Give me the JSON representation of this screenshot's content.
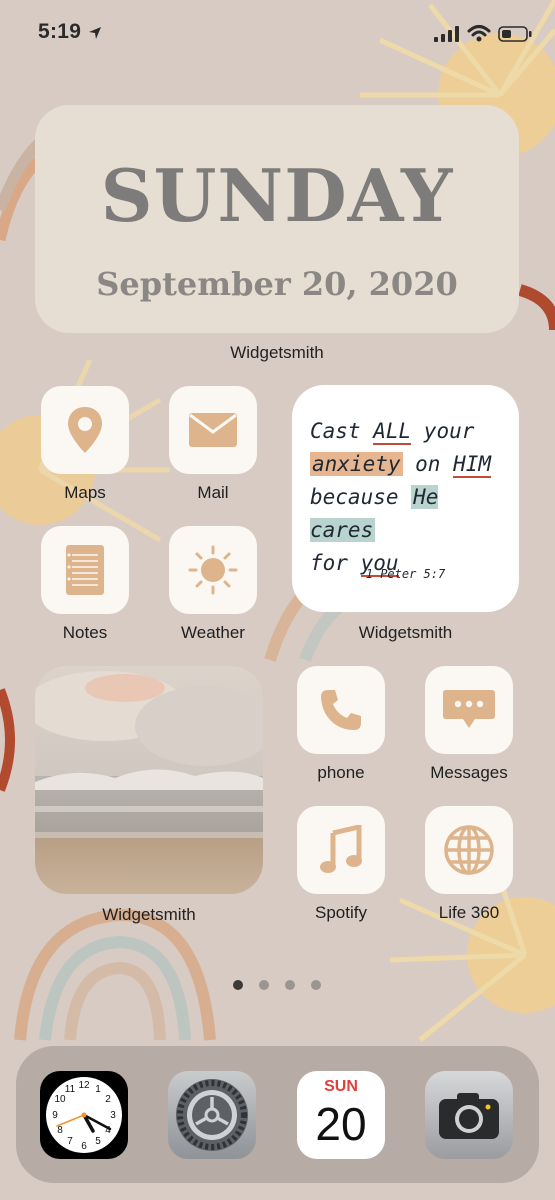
{
  "status_bar": {
    "time": "5:19",
    "icons": [
      "location-arrow-icon",
      "cellular-signal-icon",
      "wifi-icon",
      "battery-icon"
    ]
  },
  "date_widget": {
    "day": "SUNDAY",
    "date": "September 20, 2020",
    "label": "Widgetsmith"
  },
  "quote_widget": {
    "line1": "Cast ",
    "line1_em": "ALL",
    "line1_end": " your",
    "line2_hl": "anxiety",
    "line2_mid": " on ",
    "line2_em": "HIM",
    "line3": "because ",
    "line3_hl": "He cares",
    "line4": "for ",
    "line4_em": "you",
    "reference": "1 Peter 5:7",
    "label": "Widgetsmith"
  },
  "photo_widget": {
    "label": "Widgetsmith"
  },
  "apps": [
    {
      "label": "Maps",
      "icon": "map-pin-icon"
    },
    {
      "label": "Mail",
      "icon": "mail-icon"
    },
    {
      "label": "Notes",
      "icon": "notepad-icon"
    },
    {
      "label": "Weather",
      "icon": "sun-icon"
    },
    {
      "label": "phone",
      "icon": "phone-icon"
    },
    {
      "label": "Messages",
      "icon": "message-bubble-icon"
    },
    {
      "label": "Spotify",
      "icon": "music-note-icon"
    },
    {
      "label": "Life 360",
      "icon": "globe-icon"
    }
  ],
  "page_indicator": {
    "pages": 4,
    "current": 1
  },
  "dock": {
    "apps": [
      {
        "name": "Clock",
        "icon": "clock-icon",
        "numbers": [
          "12",
          "1",
          "2",
          "3",
          "4",
          "5",
          "6",
          "7",
          "8",
          "9",
          "10",
          "11"
        ]
      },
      {
        "name": "Settings",
        "icon": "gear-icon"
      },
      {
        "name": "Calendar",
        "icon": "calendar-icon",
        "day_abbrev": "SUN",
        "day_number": "20"
      },
      {
        "name": "Camera",
        "icon": "camera-icon"
      }
    ]
  },
  "colors": {
    "background": "#d8cbc4",
    "icon_accent": "#ddb48c",
    "tile": "#fbf8f4",
    "calendar_red": "#e0403a"
  }
}
